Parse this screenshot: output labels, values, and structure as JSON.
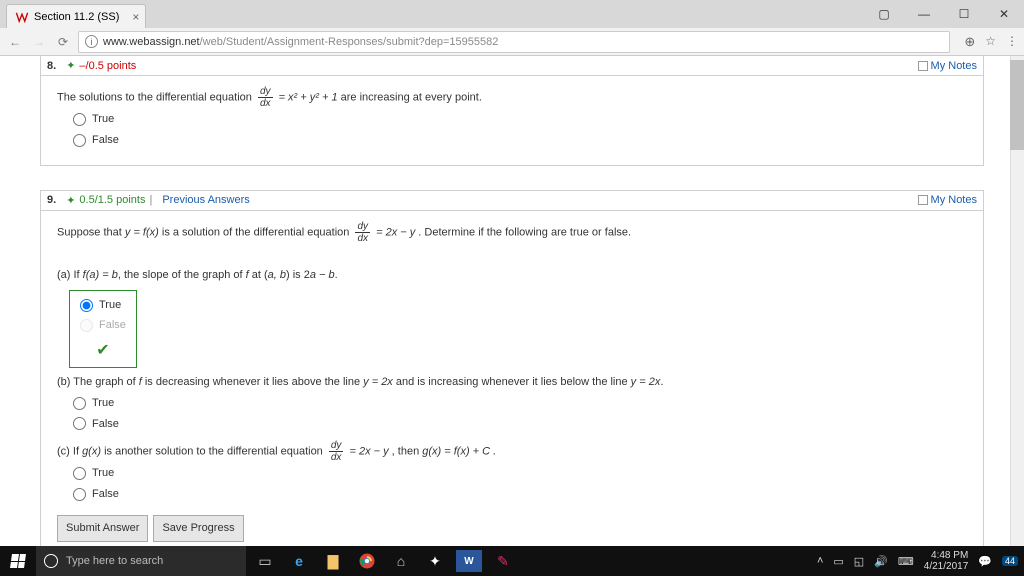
{
  "browser": {
    "tab_title": "Section 11.2 (SS)",
    "url_host": "www.webassign.net",
    "url_path": "/web/Student/Assignment-Responses/submit?dep=15955582"
  },
  "q8": {
    "num": "8.",
    "points_icon": "✦",
    "points": "–/0.5 points",
    "mynotes": "My Notes",
    "text_before": "The solutions to the differential equation ",
    "text_after": " are increasing at every point.",
    "eq_lhs_n": "dy",
    "eq_lhs_d": "dx",
    "eq_rhs": " = x² + y² + 1",
    "true_label": "True",
    "false_label": "False"
  },
  "q9": {
    "num": "9.",
    "points_icon": "✦",
    "points": "0.5/1.5 points",
    "divider": " | ",
    "prev": "Previous Answers",
    "mynotes": "My Notes",
    "intro_before": "Suppose that ",
    "intro_mid": " is a solution of the differential equation ",
    "intro_after": " . Determine if the following are true or false.",
    "y_eq_fx": "y = f(x)",
    "eq_n": "dy",
    "eq_d": "dx",
    "eq_rhs": " = 2x − y",
    "a_before": "(a) If ",
    "a_fab": "f(a) = b",
    "a_mid": ", the slope of the graph of ",
    "a_f": "f",
    "a_at": " at (",
    "a_ab": "a, b",
    "a_is": ") is 2",
    "a_amb": "a − b",
    "a_dot": ".",
    "b_before": "(b) The graph of ",
    "b_f": "f",
    "b_mid": " is decreasing whenever it lies above the line ",
    "b_line": "y = 2x",
    "b_mid2": " and is increasing whenever it lies below the line ",
    "b_line2": "y = 2x",
    "b_dot": ".",
    "c_before": "(c) If ",
    "c_gx": "g(x)",
    "c_mid": " is another solution to the differential equation ",
    "c_eq_rhs": " = 2x − y",
    "c_then": " , then ",
    "c_res": "g(x) = f(x) + C .",
    "true_label": "True",
    "false_label": "False",
    "submit": "Submit Answer",
    "save": "Save Progress"
  },
  "taskbar": {
    "search_placeholder": "Type here to search",
    "time": "4:48 PM",
    "date": "4/21/2017",
    "badge": "44"
  }
}
